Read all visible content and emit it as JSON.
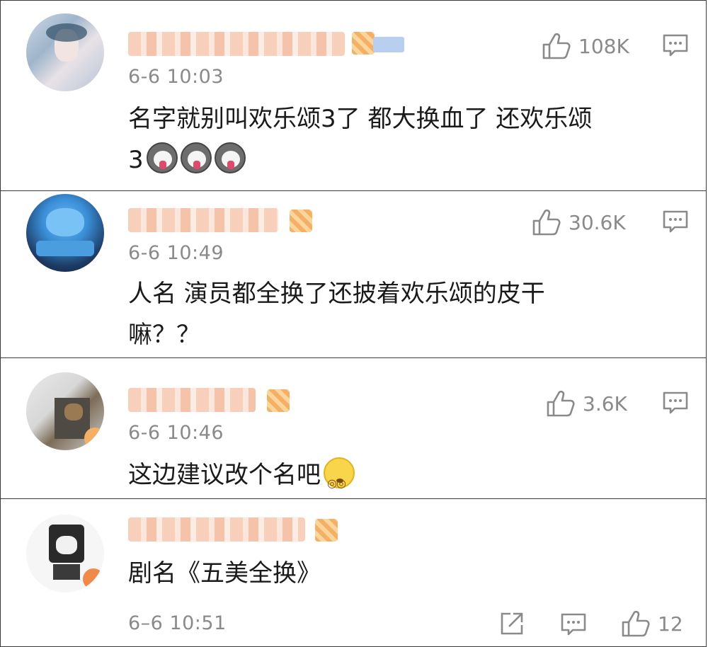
{
  "comments": [
    {
      "timestamp": "6-6 10:03",
      "likes": "108K",
      "text_line1": "名字就别叫欢乐颂3了 都大换血了 还欢乐颂",
      "text_line2": "3"
    },
    {
      "timestamp": "6-6 10:49",
      "likes": "30.6K",
      "text_line1": "人名 演员都全换了还披着欢乐颂的皮干",
      "text_line2": "嘛？？"
    },
    {
      "timestamp": "6-6 10:46",
      "likes": "3.6K",
      "text_line1": "这边建议改个名吧"
    },
    {
      "timestamp": "6–6 10:51",
      "likes": "12",
      "text_line1": "剧名《五美全换》"
    }
  ],
  "icons": {
    "like": "thumbs-up-icon",
    "reply": "comment-icon",
    "share": "share-icon",
    "emoji_dog": "husky-dog-emoji",
    "emoji_dizzy": "dizzy-face-emoji"
  },
  "colors": {
    "border": "#3a3a3a",
    "meta_text": "#8a8a8a",
    "body_text": "#1a1a1a"
  }
}
